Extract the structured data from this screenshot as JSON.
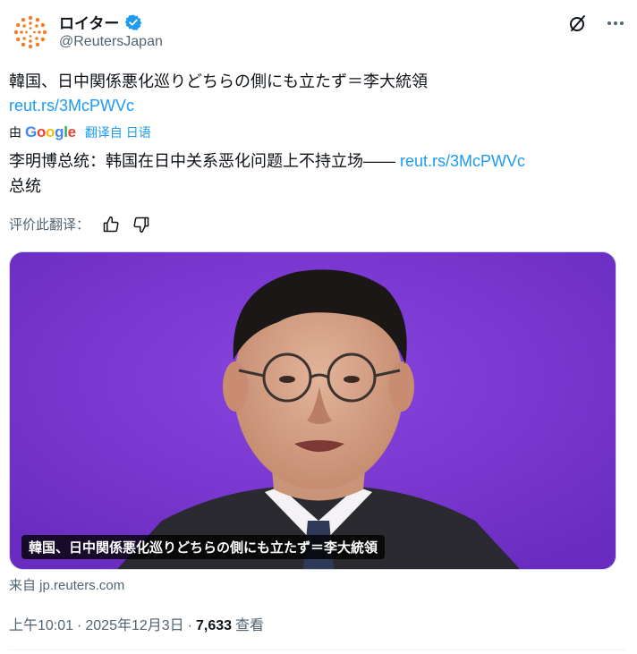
{
  "account": {
    "display_name": "ロイター",
    "handle": "@ReutersJapan",
    "avatar_icon": "reuters-logo-icon",
    "verified_icon": "verified-badge-icon",
    "brand_color": "#f07f2b"
  },
  "header_actions": {
    "grok_icon": "grok-icon",
    "more_icon": "more-options-icon"
  },
  "post": {
    "text": "韓国、日中関係悪化巡りどちらの側にも立たず＝李大統領",
    "link": "reut.rs/3McPWVc"
  },
  "translation": {
    "by_label": "由",
    "provider_parts": [
      "G",
      "o",
      "o",
      "g",
      "l",
      "e"
    ],
    "action": "翻译自 日语",
    "text": "李明博总统：韩国在日中关系恶化问题上不持立场——",
    "link": "reut.rs/3McPWVc",
    "tail": "总统",
    "rate_label": "评价此翻译：",
    "thumbs_up_icon": "thumbs-up-icon",
    "thumbs_down_icon": "thumbs-down-icon"
  },
  "media": {
    "caption": "韓国、日中関係悪化巡りどちらの側にも立たず＝李大統領",
    "background_color": "#7b35d2"
  },
  "source": {
    "label": "来自 jp.reuters.com"
  },
  "meta": {
    "time": "上午10:01",
    "sep1": "·",
    "date": "2025年12月3日",
    "sep2": "·",
    "views_count": "7,633",
    "views_label": "查看"
  },
  "colors": {
    "link": "#1d9bf0",
    "muted": "#536471",
    "text": "#0f1419"
  }
}
